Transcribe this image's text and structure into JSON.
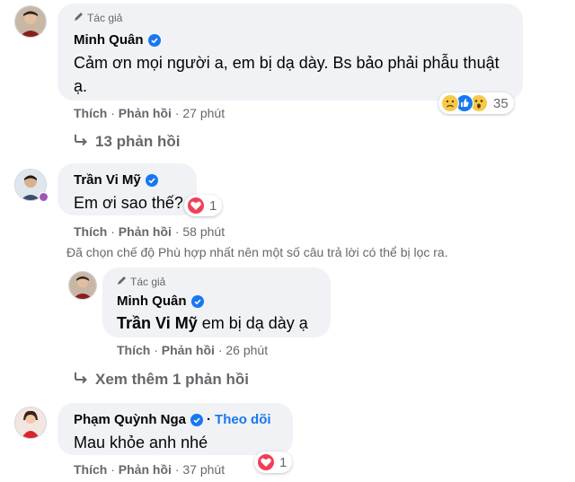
{
  "comments": [
    {
      "author_tag": "Tác giả",
      "name": "Minh Quân",
      "text": "Cảm ơn mọi người a, em bị dạ dày. Bs bảo phải phẫu thuật ạ.",
      "reaction_count": "35",
      "like_label": "Thích",
      "reply_label": "Phản hồi",
      "time": "27 phút",
      "replies_link": "13 phản hồi"
    },
    {
      "name": "Trần Vi Mỹ",
      "text": "Em ơi sao thế?",
      "reaction_count": "1",
      "like_label": "Thích",
      "reply_label": "Phản hồi",
      "time": "58 phút",
      "filter_note": "Đã chọn chế độ Phù hợp nhất nên một số câu trả lời có thể bị lọc ra.",
      "reply": {
        "author_tag": "Tác giả",
        "name": "Minh Quân",
        "mention": "Trần Vi Mỹ",
        "text": "em bị dạ dày ạ",
        "like_label": "Thích",
        "reply_label": "Phản hồi",
        "time": "26 phút"
      },
      "more_replies_link": "Xem thêm 1 phản hồi"
    },
    {
      "name": "Phạm Quỳnh Nga",
      "follow_label": "Theo dõi",
      "text": "Mau khỏe anh nhé",
      "reaction_count": "1",
      "like_label": "Thích",
      "reply_label": "Phản hồi",
      "time": "37 phút"
    }
  ],
  "separator": "·",
  "colors": {
    "bubble": "#f0f2f5",
    "verified": "#1877f2",
    "muted": "#65676b",
    "follow": "#1877f2",
    "love": "#f33e58"
  },
  "icons": {
    "author_tag": "pencil-icon",
    "verified": "verified-badge-icon",
    "reply_arrow": "reply-arrow-icon",
    "reactions": [
      "sad-emoji-icon",
      "like-icon",
      "wow-emoji-icon",
      "love-icon"
    ]
  }
}
